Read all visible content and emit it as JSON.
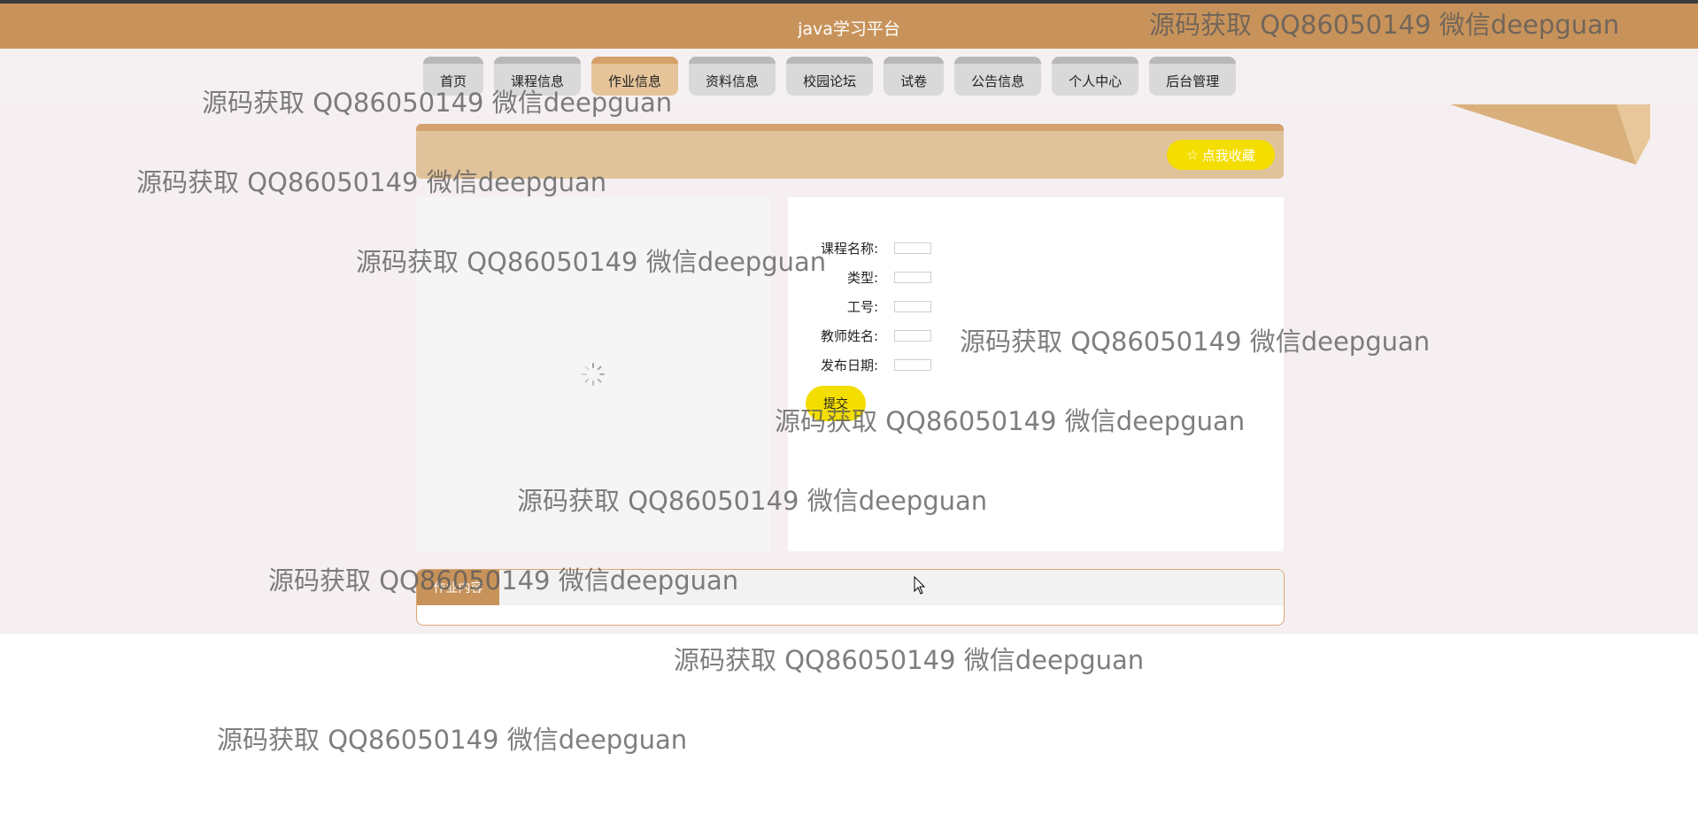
{
  "header": {
    "title": "java学习平台"
  },
  "nav": {
    "items": [
      "首页",
      "课程信息",
      "作业信息",
      "资料信息",
      "校园论坛",
      "试卷",
      "公告信息",
      "个人中心",
      "后台管理"
    ],
    "active_index": 2
  },
  "banner": {
    "favorite_icon": "star-outline-icon",
    "favorite_label": "点我收藏"
  },
  "form": {
    "fields": [
      {
        "label": "课程名称:",
        "value": ""
      },
      {
        "label": "类型:",
        "value": ""
      },
      {
        "label": "工号:",
        "value": ""
      },
      {
        "label": "教师姓名:",
        "value": ""
      },
      {
        "label": "发布日期:",
        "value": ""
      }
    ],
    "submit_label": "提交"
  },
  "content": {
    "tab_label": "作业内容"
  },
  "watermark": {
    "text": "源码获取 QQ86050149 微信deepguan"
  },
  "colors": {
    "header": "#c8935b",
    "accent": "#f4de00",
    "banner": "#e0c39a"
  }
}
